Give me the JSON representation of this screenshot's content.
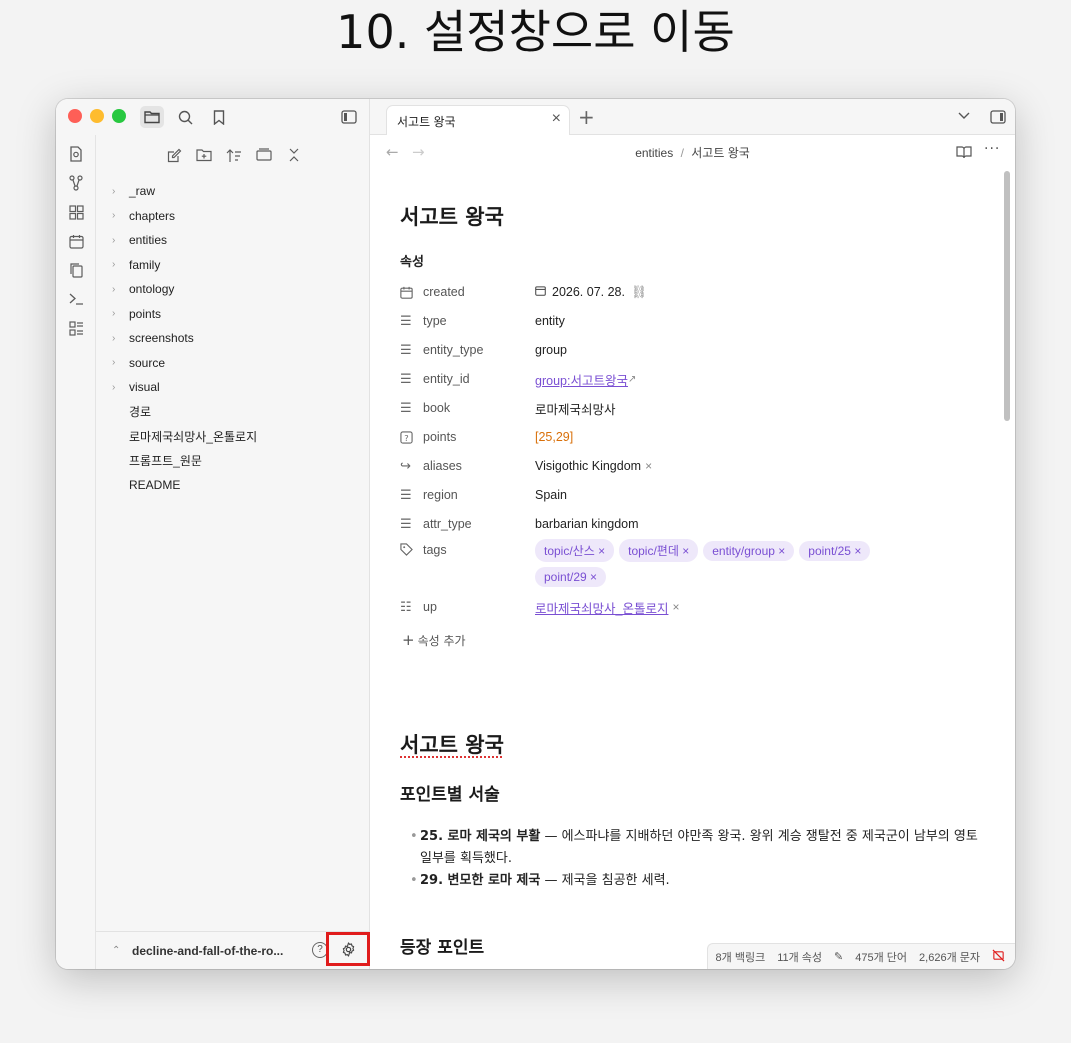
{
  "headline": "10. 설정창으로 이동",
  "sidebar": {
    "tree": [
      {
        "label": "_raw",
        "folder": true
      },
      {
        "label": "chapters",
        "folder": true
      },
      {
        "label": "entities",
        "folder": true
      },
      {
        "label": "family",
        "folder": true
      },
      {
        "label": "ontology",
        "folder": true
      },
      {
        "label": "points",
        "folder": true
      },
      {
        "label": "screenshots",
        "folder": true
      },
      {
        "label": "source",
        "folder": true
      },
      {
        "label": "visual",
        "folder": true
      },
      {
        "label": "경로",
        "folder": false
      },
      {
        "label": "로마제국쇠망사_온톨로지",
        "folder": false
      },
      {
        "label": "프롬프트_원문",
        "folder": false
      },
      {
        "label": "README",
        "folder": false
      }
    ],
    "vault_name": "decline-and-fall-of-the-ro...",
    "help_glyph": "?"
  },
  "tab": {
    "title": "서고트 왕국"
  },
  "breadcrumb": {
    "folder": "entities",
    "sep": "/",
    "current": "서고트 왕국"
  },
  "note": {
    "title": "서고트 왕국",
    "properties_label": "속성",
    "properties": {
      "created": {
        "key": "created",
        "value": "2026. 07. 28."
      },
      "type": {
        "key": "type",
        "value": "entity"
      },
      "entity_type": {
        "key": "entity_type",
        "value": "group"
      },
      "entity_id": {
        "key": "entity_id",
        "value": "group:서고트왕국"
      },
      "book": {
        "key": "book",
        "value": "로마제국쇠망사"
      },
      "points": {
        "key": "points",
        "value": "[25,29]"
      },
      "aliases": {
        "key": "aliases",
        "value": "Visigothic Kingdom"
      },
      "region": {
        "key": "region",
        "value": "Spain"
      },
      "attr_type": {
        "key": "attr_type",
        "value": "barbarian kingdom"
      },
      "tags": {
        "key": "tags",
        "values": [
          "topic/산스",
          "topic/편데",
          "entity/group",
          "point/25",
          "point/29"
        ]
      },
      "up": {
        "key": "up",
        "value": "로마제국쇠망사_온톨로지"
      }
    },
    "add_property": "속성 추가",
    "heading1": "서고트 왕국",
    "section1": "포인트별 서술",
    "bullet1_bold": "25. 로마 제국의 부활",
    "bullet1_text": " — 에스파냐를 지배하던 야만족 왕국. 왕위 계승 쟁탈전 중 제국군이 남부의 영토 일부를 획득했다.",
    "bullet2_bold": "29. 변모한 로마 제국",
    "bullet2_text": " — 제국을 침공한 세력.",
    "section2": "등장 포인트"
  },
  "status_bar": {
    "backlinks": "8개 백링크",
    "properties": "11개 속성",
    "words": "475개 단어",
    "chars": "2,626개 문자"
  },
  "colors": {
    "accent": "#7a4fd3",
    "highlight_box": "#e01c1c",
    "number": "#d9700a"
  }
}
